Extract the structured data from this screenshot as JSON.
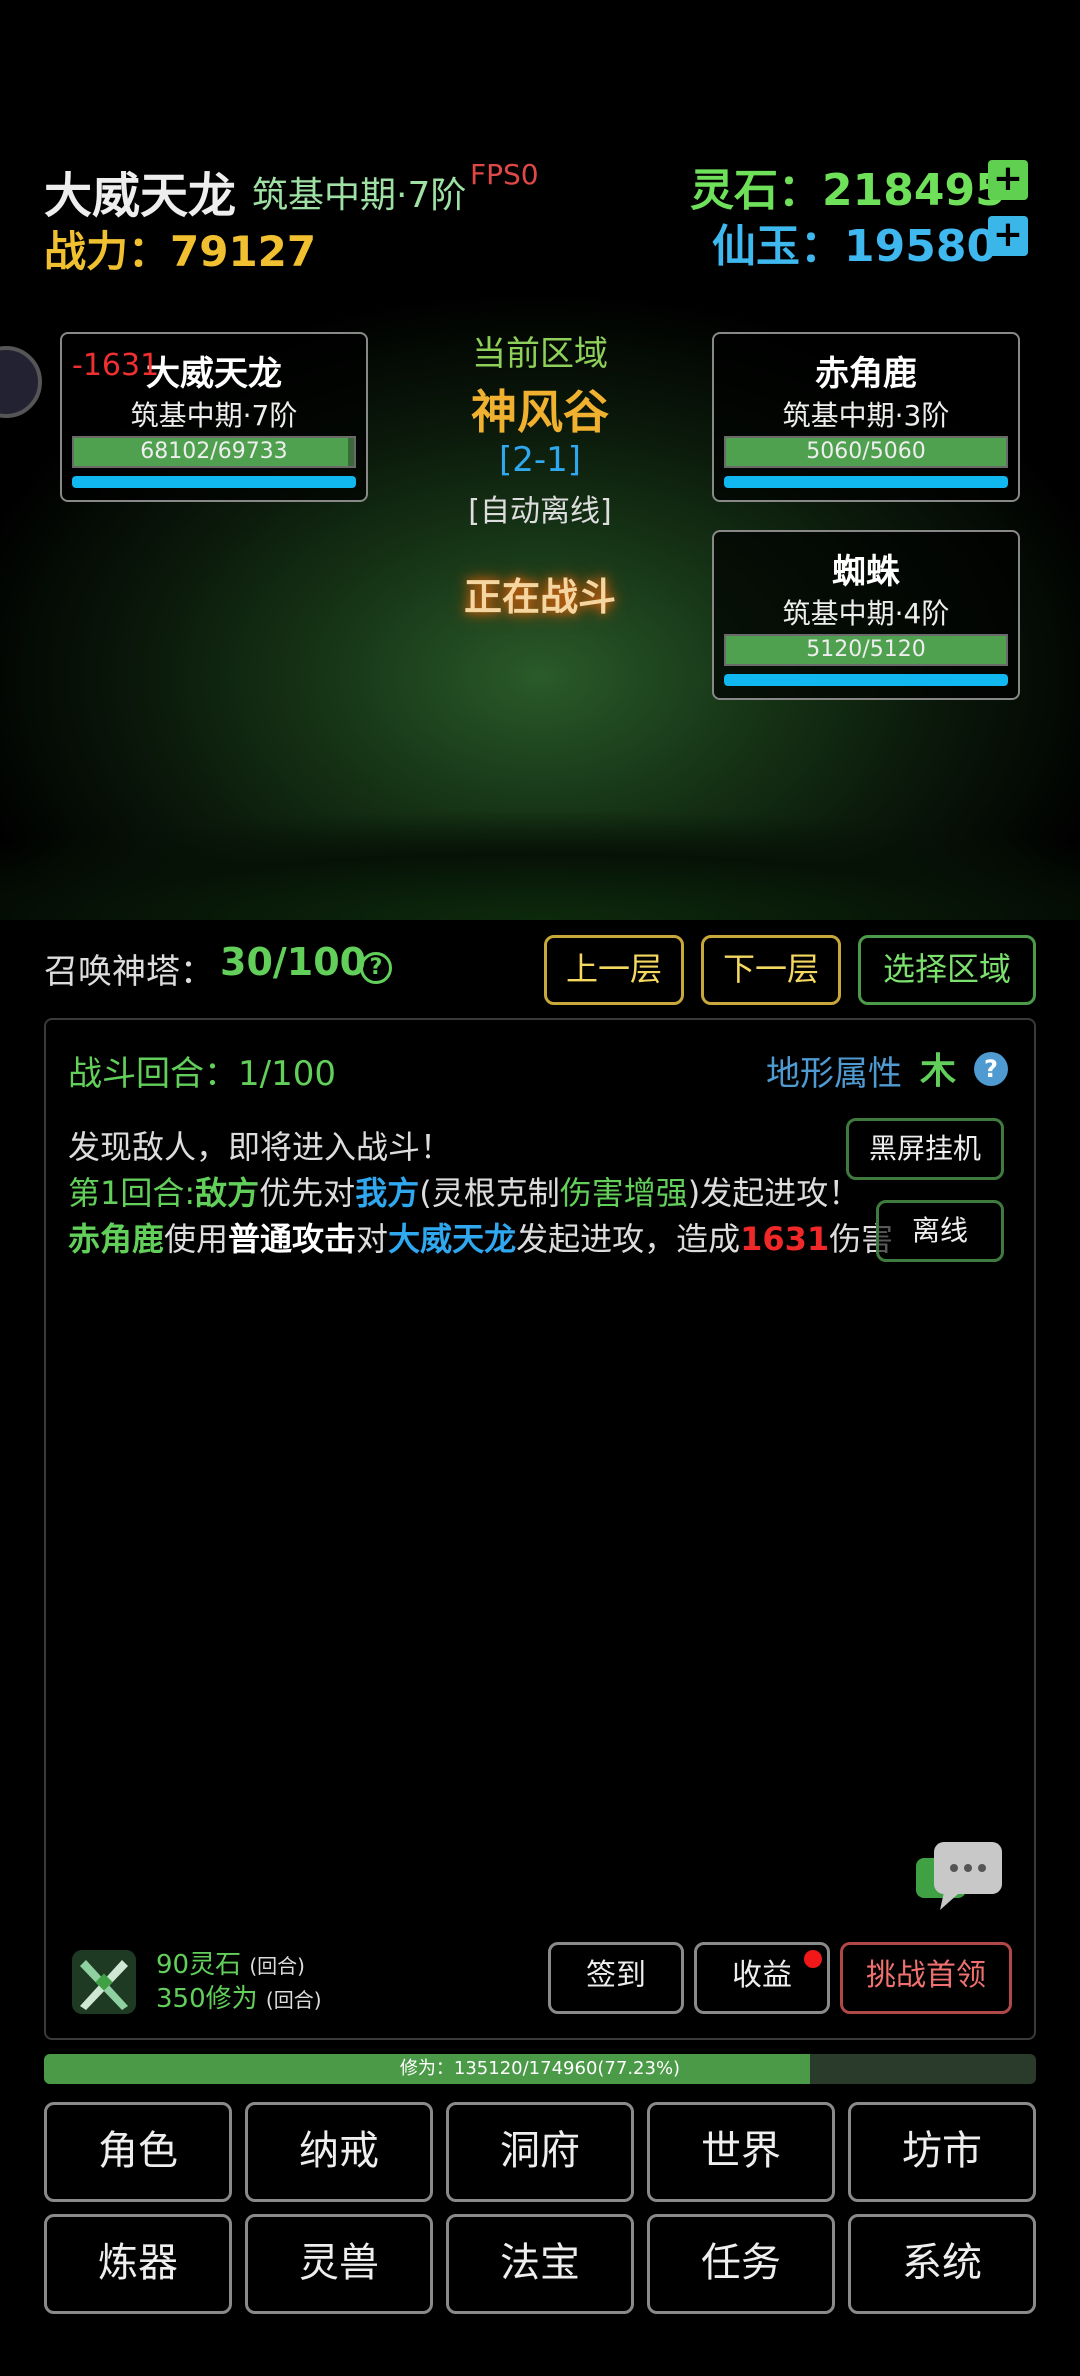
{
  "header": {
    "player_name": "大威天龙",
    "realm": "筑基中期·7阶",
    "fps": "FPS0",
    "power_label": "战力：",
    "power": "79127",
    "lingshi_label": "灵石：",
    "lingshi": "218495",
    "xianyu_label": "仙玉：",
    "xianyu": "19580"
  },
  "battle": {
    "player_card": {
      "damage": "-1631",
      "name": "大威天龙",
      "realm": "筑基中期·7阶",
      "hp": "68102/69733",
      "hp_fraction": 0.977
    },
    "area": {
      "label": "当前区域",
      "name": "神风谷",
      "stage": "[2-1]",
      "mode": "[自动离线]"
    },
    "status": "正在战斗",
    "enemies": [
      {
        "name": "赤角鹿",
        "realm": "筑基中期·3阶",
        "hp": "5060/5060",
        "hp_fraction": 1.0
      },
      {
        "name": "蜘蛛",
        "realm": "筑基中期·4阶",
        "hp": "5120/5120",
        "hp_fraction": 1.0
      }
    ]
  },
  "tower": {
    "label": "召唤神塔：",
    "value": "30/100",
    "help": "?",
    "prev": "上一层",
    "next": "下一层",
    "select": "选择区域"
  },
  "log_panel": {
    "round_label": "战斗回合：1/100",
    "terrain_label": "地形属性",
    "terrain_value": "木",
    "help": "?",
    "black_screen": "黑屏挂机",
    "offline": "离线",
    "line1": "发现敌人，即将进入战斗！",
    "line2": {
      "a": "第1回合:",
      "b": "敌方",
      "c": "优先对",
      "d": "我方",
      "e": "(灵根克制",
      "f": "伤害增强",
      "g": ")发起进攻！"
    },
    "line3": {
      "a": "赤角鹿",
      "b": "使用",
      "c": "普通攻击",
      "d": "对",
      "e": "大威天龙",
      "f": "发起进攻，造成",
      "g": "1631",
      "h": "伤害"
    },
    "reward1": "90灵石",
    "reward1_unit": "(回合)",
    "reward2": "350修为",
    "reward2_unit": "(回合)",
    "checkin": "签到",
    "income": "收益",
    "boss": "挑战首领"
  },
  "cultivation": {
    "text": "修为：135120/174960(77.23%)",
    "fraction": 0.7723
  },
  "nav": {
    "row1": [
      "角色",
      "纳戒",
      "洞府",
      "世界",
      "坊市"
    ],
    "row2": [
      "炼器",
      "灵兽",
      "法宝",
      "任务",
      "系统"
    ]
  },
  "colors": {
    "accent_green": "#62cf5a",
    "accent_blue": "#2fa8f0",
    "gold": "#f0c030",
    "damage_red": "#f02828"
  },
  "icons": [
    "plus-icon",
    "help-icon",
    "chat-icon",
    "sword-icon"
  ]
}
